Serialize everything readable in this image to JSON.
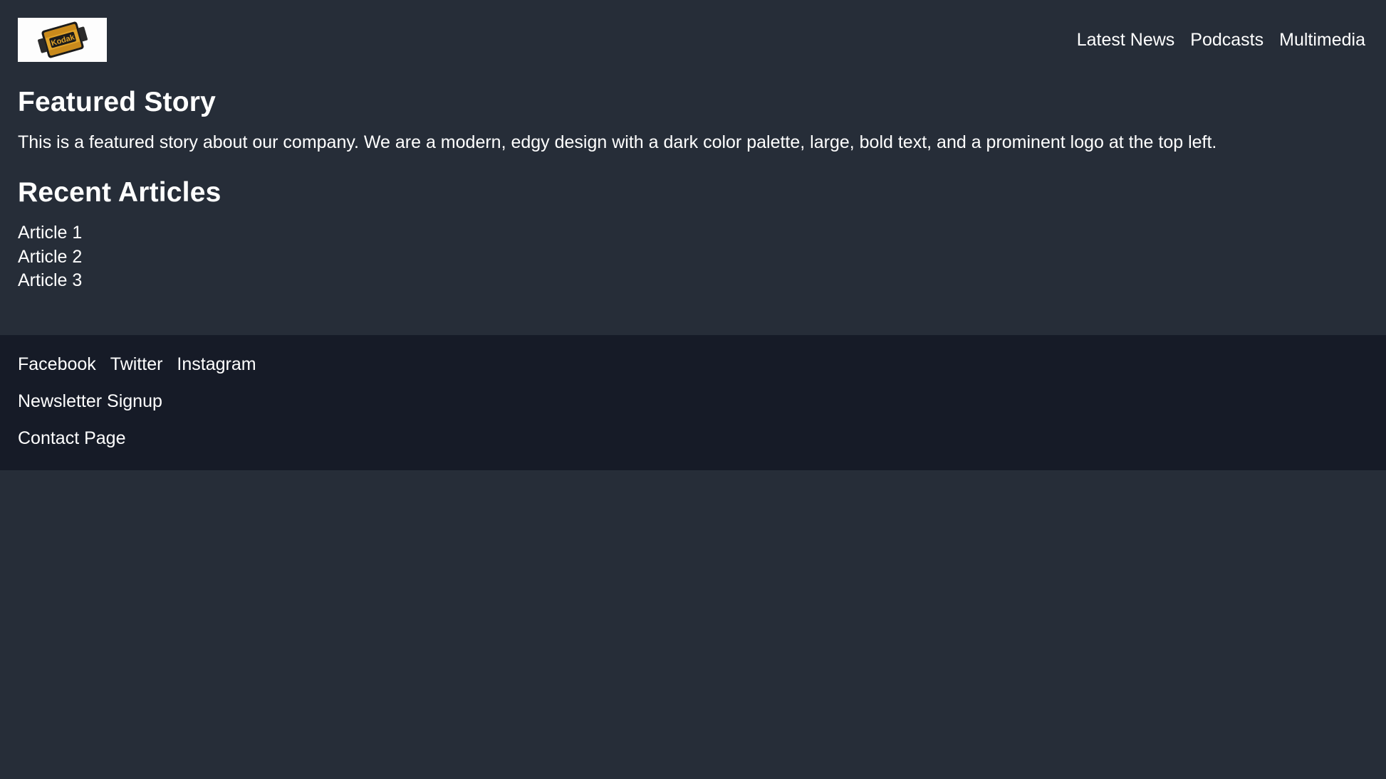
{
  "header": {
    "logo": {
      "icon": "film-canister-logo",
      "alt_text": "Kodak film canister logo"
    },
    "nav": [
      {
        "label": "Latest News"
      },
      {
        "label": "Podcasts"
      },
      {
        "label": "Multimedia"
      }
    ]
  },
  "main": {
    "featured": {
      "title": "Featured Story",
      "body": "This is a featured story about our company. We are a modern, edgy design with a dark color palette, large, bold text, and a prominent logo at the top left."
    },
    "recent": {
      "title": "Recent Articles",
      "items": [
        {
          "label": "Article 1"
        },
        {
          "label": "Article 2"
        },
        {
          "label": "Article 3"
        }
      ]
    }
  },
  "footer": {
    "social": [
      {
        "label": "Facebook"
      },
      {
        "label": "Twitter"
      },
      {
        "label": "Instagram"
      }
    ],
    "newsletter_label": "Newsletter Signup",
    "contact_label": "Contact Page"
  },
  "colors": {
    "page_background": "#262d38",
    "footer_background": "#161b27",
    "text": "#ffffff",
    "logo_background": "#fdfdfd",
    "logo_accent": "#e0a32a"
  }
}
